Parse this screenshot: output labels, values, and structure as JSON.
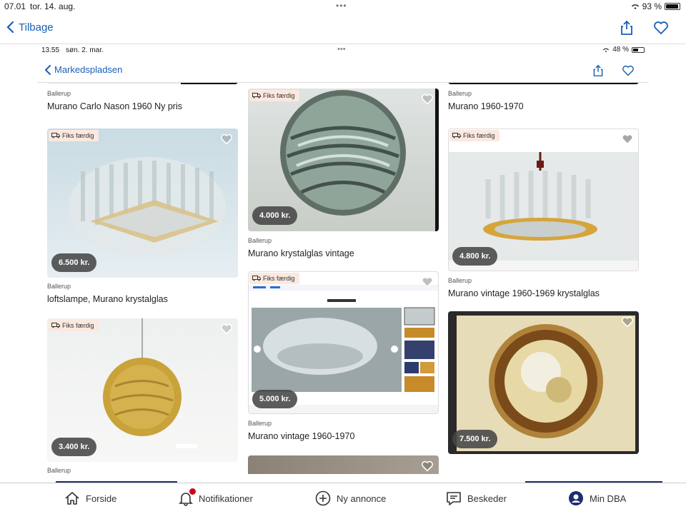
{
  "status": {
    "time": "07.01",
    "date": "tor. 14. aug.",
    "battery": "93 %",
    "battery_level": 0.93
  },
  "nav": {
    "back_label": "Tilbage"
  },
  "inner": {
    "status": {
      "time": "13.55",
      "date": "søn. 2. mar.",
      "battery": "48 %",
      "battery_level": 0.48
    },
    "nav": {
      "back_label": "Markedspladsen"
    }
  },
  "listings": [
    {
      "location": "Ballerup",
      "title": "Murano Carlo Nason 1960 Ny pris"
    },
    {
      "location": "Ballerup",
      "title": "loftslampe, Murano krystalglas",
      "price": "6.500 kr.",
      "badge": "Fiks færdig"
    },
    {
      "location": "Ballerup",
      "title": "",
      "price": "3.400 kr.",
      "badge": "Fiks færdig"
    },
    {
      "location": "Ballerup",
      "title": "Murano krystalglas vintage",
      "price": "4.000 kr.",
      "badge": "Fiks færdig"
    },
    {
      "location": "Ballerup",
      "title": "Murano vintage 1960-1970",
      "price": "5.000 kr.",
      "badge": "Fiks færdig"
    },
    {
      "location": "Ballerup",
      "title": "Murano 1960-1970"
    },
    {
      "location": "Ballerup",
      "title": "Murano vintage 1960-1969 krystalglas",
      "price": "4.800 kr.",
      "badge": "Fiks færdig"
    },
    {
      "location": "",
      "title": "",
      "price": "7.500 kr."
    }
  ],
  "tabs": [
    {
      "label": "Forside",
      "icon": "home-icon"
    },
    {
      "label": "Notifikationer",
      "icon": "bell-icon"
    },
    {
      "label": "Ny annonce",
      "icon": "plus-circle-icon"
    },
    {
      "label": "Beskeder",
      "icon": "chat-icon"
    },
    {
      "label": "Min DBA",
      "icon": "user-icon"
    }
  ],
  "colors": {
    "accent": "#1a5fb4",
    "tab_active": "#1d2f6f",
    "badge_bg": "#fbe8df",
    "notif": "#d0021b"
  }
}
